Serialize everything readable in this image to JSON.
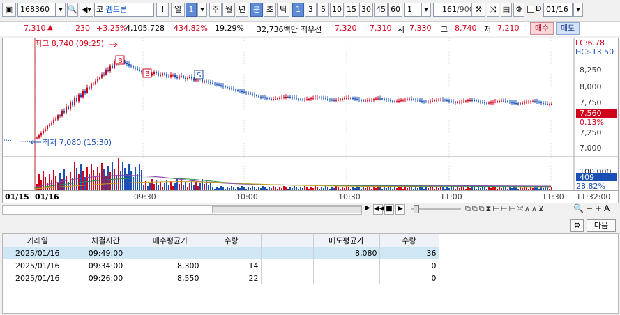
{
  "toolbar": {
    "stock_code": "168360",
    "market": "코",
    "stock_name": "펨트론",
    "warn": "!",
    "period_buttons": [
      "일",
      "1",
      "주",
      "월",
      "년",
      "분",
      "초",
      "틱"
    ],
    "intervals": [
      "1",
      "3",
      "5",
      "10",
      "15",
      "30",
      "45",
      "60"
    ],
    "interval_value": "1",
    "count_value": "161",
    "count_total": "/900",
    "d_label": "D",
    "date_value": "01/16"
  },
  "quote": {
    "price": "7,310",
    "change_arrow": "▲",
    "change": "230",
    "rate": "+3.25%",
    "volume": "4,105,728",
    "vol_rate": "434.82%",
    "turnover": "19.29%",
    "amount": "32,736백만",
    "best_label": "최우선",
    "best_ask": "7,320",
    "best_bid": "7,310",
    "open_label": "시",
    "open": "7,330",
    "high_label": "고",
    "high": "8,740",
    "low_label": "저",
    "low": "7,210",
    "buy_button": "매수",
    "sell_button": "매도"
  },
  "chart_annotations": {
    "high": "최고 8,740 (09:25)",
    "low": "최저 7,080 (15:30)",
    "lc": "LC:6.78",
    "hc": "HC:-13.50",
    "current_price": "7,560",
    "current_rate": "0.13%",
    "volume_label": "100,000",
    "volume_value": "409",
    "volume_rate": "28.82%",
    "markers": [
      "B",
      "B",
      "S"
    ]
  },
  "price_axis": [
    "8,250",
    "8,000",
    "7,750",
    "7,250",
    "7,000"
  ],
  "time_axis": {
    "labels": [
      "01/15",
      "01/16",
      "09:30",
      "10:00",
      "10:30",
      "11:00",
      "11:30"
    ],
    "end_time": "11:32:00"
  },
  "grid_toolbar": {
    "settings_icon": "gear-icon",
    "next_button": "다음"
  },
  "trades": {
    "columns": [
      "거래일",
      "체결시간",
      "매수평균가",
      "수량",
      "",
      "매도평균가",
      "수량"
    ],
    "rows": [
      [
        "2025/01/16",
        "09:49:00",
        "",
        "",
        "",
        "8,080",
        "36"
      ],
      [
        "2025/01/16",
        "09:34:00",
        "8,300",
        "14",
        "",
        "",
        "0"
      ],
      [
        "2025/01/16",
        "09:26:00",
        "8,550",
        "22",
        "",
        "",
        "0"
      ]
    ]
  },
  "colors": {
    "up": "#d0021b",
    "down": "#1a4fb5",
    "accent": "#3d6ec9"
  }
}
